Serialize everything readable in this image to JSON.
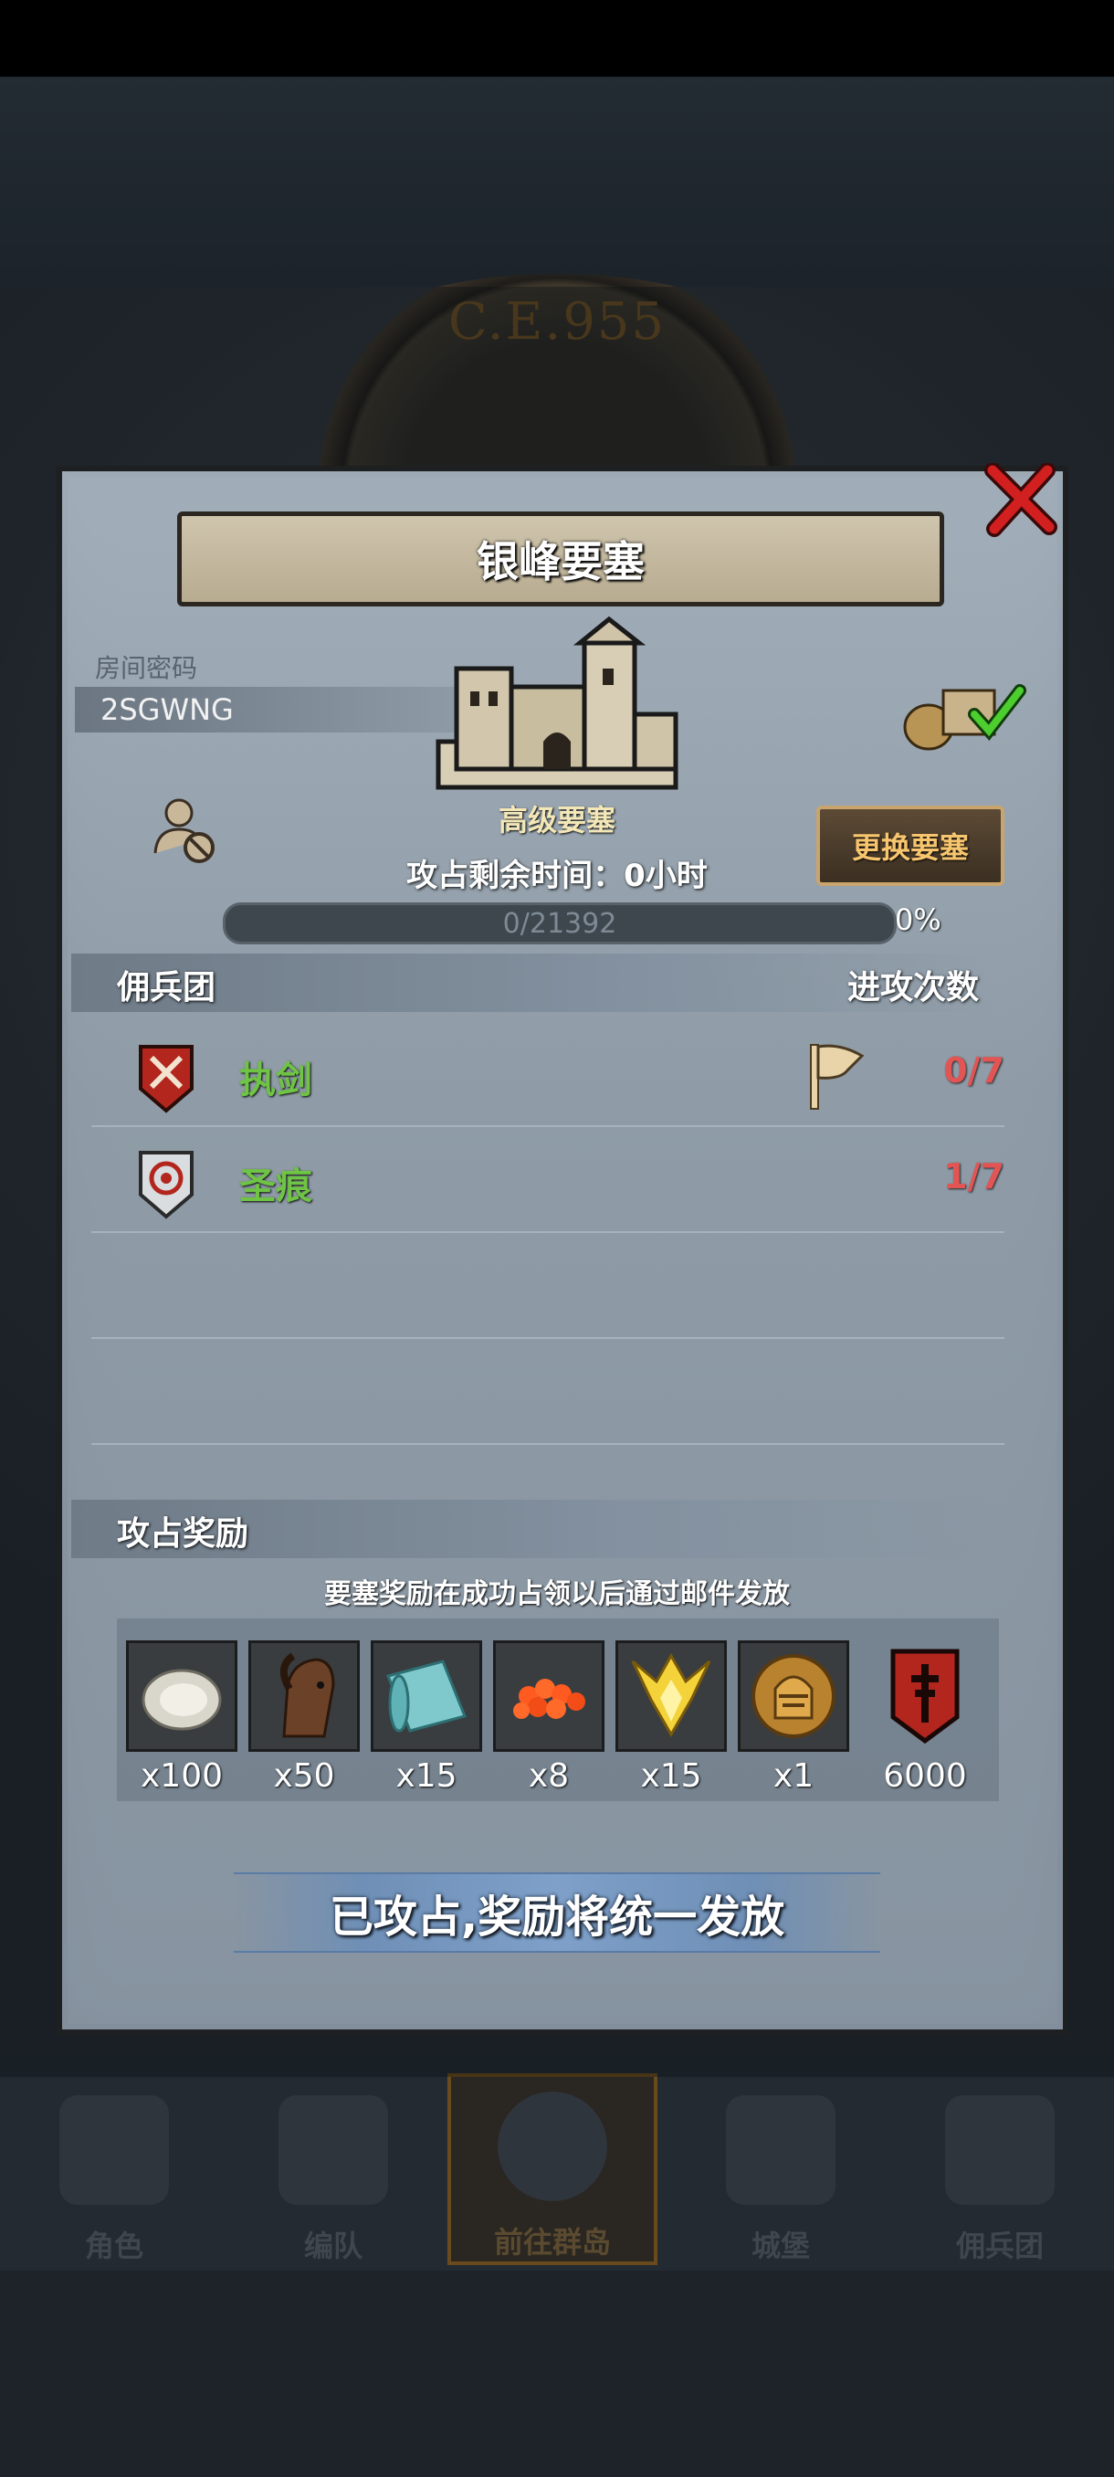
{
  "background": {
    "era_label": "C.E.955"
  },
  "bottom_nav": {
    "items": [
      {
        "label": "角色"
      },
      {
        "label": "编队"
      },
      {
        "label": "前往群岛"
      },
      {
        "label": "城堡"
      },
      {
        "label": "佣兵团"
      }
    ],
    "active_index": 2
  },
  "dialog": {
    "title": "银峰要塞",
    "room_password_label": "房间密码",
    "room_password": "2SGWNG",
    "fortress_level": "高级要塞",
    "capture_time_text": "攻占剩余时间：0小时",
    "progress_text": "0/21392",
    "progress_percent_text": "0%",
    "progress_fraction": 0.0,
    "change_button": "更换要塞",
    "mercenary_section": {
      "title": "佣兵团",
      "attack_count_header": "进攻次数",
      "rows": [
        {
          "name": "执剑",
          "count": "0/7",
          "badge_icon": "crossed-swords-shield-icon",
          "flag": true
        },
        {
          "name": "圣痕",
          "count": "1/7",
          "badge_icon": "target-shield-icon",
          "flag": false
        }
      ]
    },
    "reward_section": {
      "title": "攻占奖励",
      "note": "要塞奖励在成功占领以后通过邮件发放",
      "items": [
        {
          "icon": "oyster-icon",
          "qty": "x100"
        },
        {
          "icon": "horse-icon",
          "qty": "x50"
        },
        {
          "icon": "cloth-roll-icon",
          "qty": "x15"
        },
        {
          "icon": "caviar-icon",
          "qty": "x8"
        },
        {
          "icon": "golden-crest-icon",
          "qty": "x15"
        },
        {
          "icon": "knight-helmet-coin-icon",
          "qty": "x1"
        },
        {
          "icon": "guild-banner-icon",
          "qty": "6000"
        }
      ]
    },
    "captured_status": "已攻占,奖励将统一发放"
  },
  "colors": {
    "mercenary_name": "#6fc345",
    "attack_count": "#e25555",
    "change_button_text": "#f7c56e",
    "close_x": "#d21f1f"
  }
}
